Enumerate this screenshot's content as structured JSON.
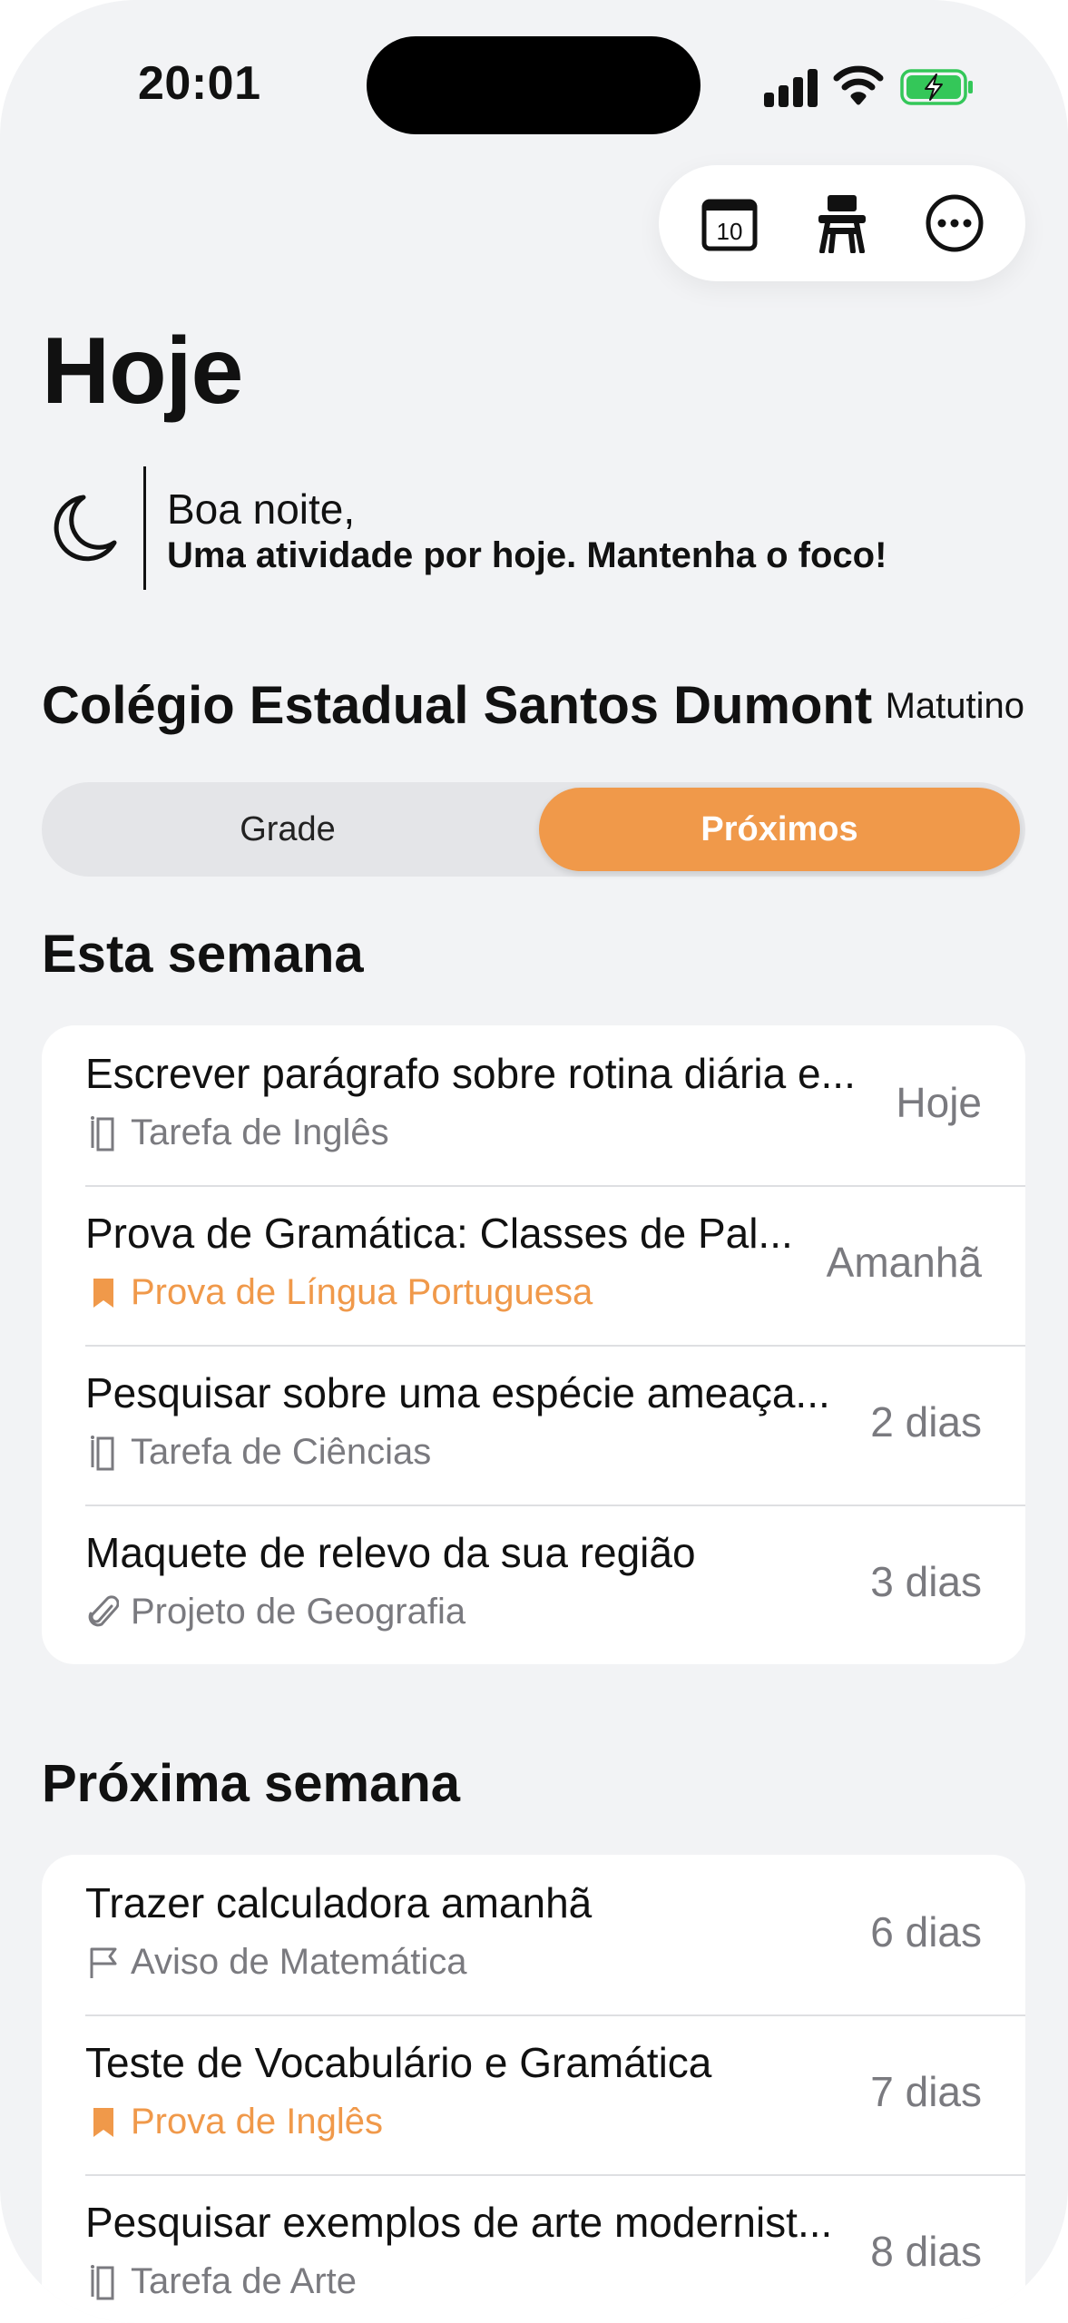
{
  "status_bar": {
    "time": "20:01"
  },
  "toolbar": {
    "icons": [
      "calendar-icon",
      "school-desk-icon",
      "more-icon"
    ],
    "calendar_day": "10"
  },
  "page": {
    "title": "Hoje"
  },
  "greeting": {
    "icon": "moon-icon",
    "line1": "Boa noite,",
    "line2": "Uma atividade por hoje. Mantenha o foco!"
  },
  "school": {
    "name": "Colégio Estadual Santos Dumont",
    "shift": "Matutino"
  },
  "segments": {
    "left": "Grade",
    "right": "Próximos",
    "selected": "Próximos"
  },
  "colors": {
    "accent": "#f0994a",
    "background": "#f2f3f5",
    "muted": "#7a7a7f"
  },
  "sections": [
    {
      "title": "Esta semana",
      "items": [
        {
          "title": "Escrever parágrafo sobre rotina diária e...",
          "subtitle": "Tarefa de Inglês",
          "icon": "book-icon",
          "accent": false,
          "due": "Hoje"
        },
        {
          "title": "Prova de Gramática: Classes de Pal...",
          "subtitle": "Prova de Língua Portuguesa",
          "icon": "bookmark-icon",
          "accent": true,
          "due": "Amanhã"
        },
        {
          "title": "Pesquisar sobre uma espécie ameaça...",
          "subtitle": "Tarefa de Ciências",
          "icon": "book-icon",
          "accent": false,
          "due": "2 dias"
        },
        {
          "title": "Maquete de relevo da sua região",
          "subtitle": "Projeto de Geografia",
          "icon": "paperclip-icon",
          "accent": false,
          "due": "3 dias"
        }
      ]
    },
    {
      "title": "Próxima semana",
      "items": [
        {
          "title": "Trazer calculadora amanhã",
          "subtitle": "Aviso de Matemática",
          "icon": "flag-icon",
          "accent": false,
          "due": "6 dias"
        },
        {
          "title": "Teste de Vocabulário e Gramática",
          "subtitle": "Prova de Inglês",
          "icon": "bookmark-icon",
          "accent": true,
          "due": "7 dias"
        },
        {
          "title": "Pesquisar exemplos de arte modernist...",
          "subtitle": "Tarefa de Arte",
          "icon": "book-icon",
          "accent": false,
          "due": "8 dias"
        }
      ]
    }
  ]
}
